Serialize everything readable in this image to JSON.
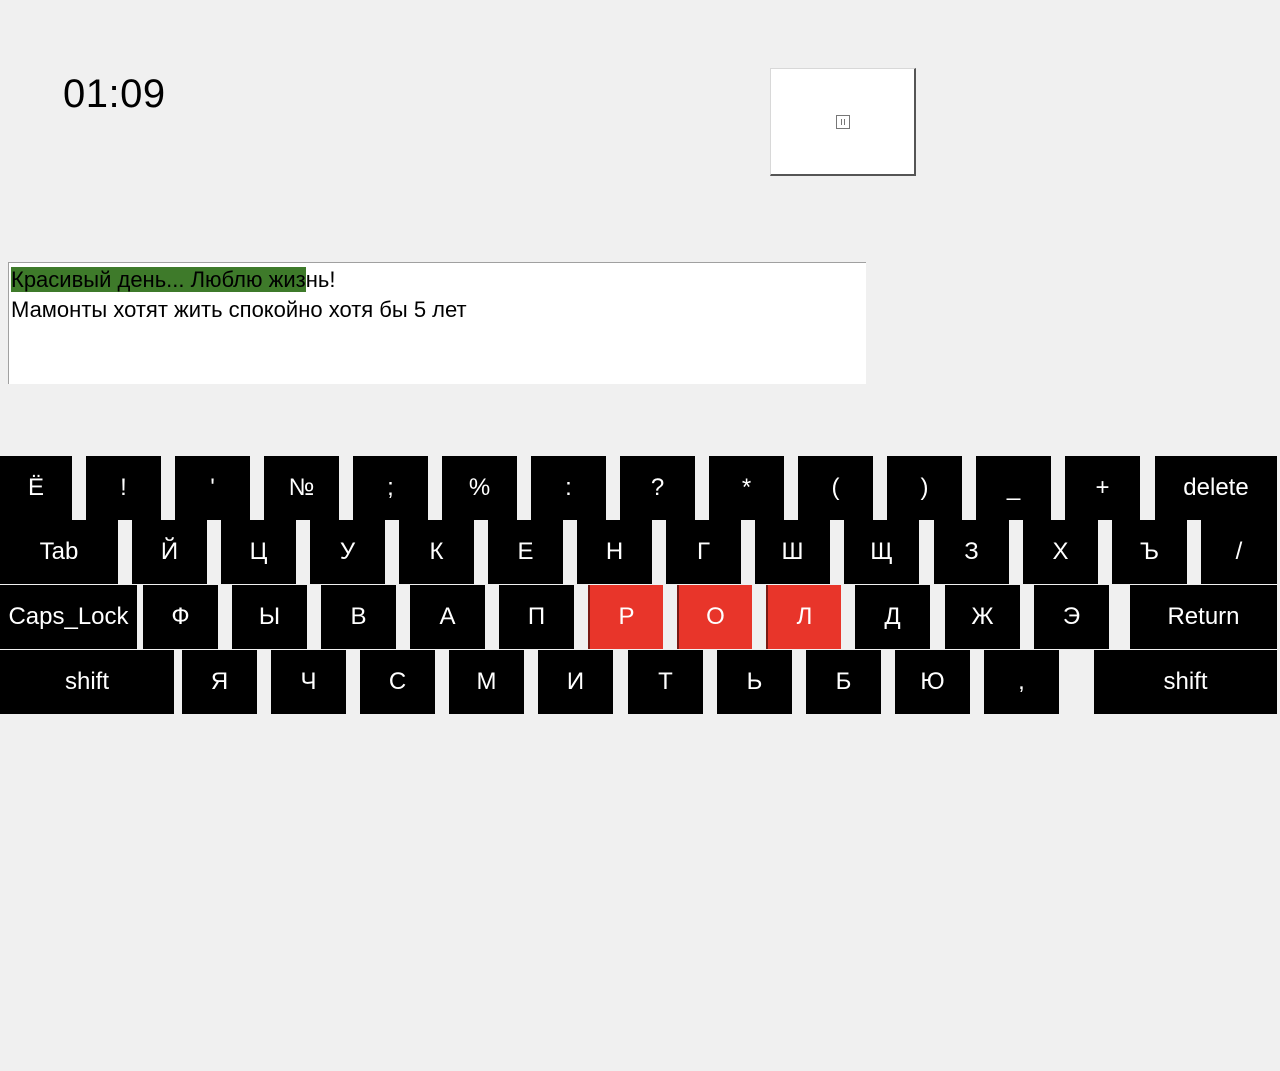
{
  "timer": "01:09",
  "pause_button": {
    "icon": "pause-icon"
  },
  "text": {
    "line1_typed": "Красивый день... Люблю жиз",
    "line1_rest": "нь!",
    "line2": "Мамонты хотят жить спокойно хотя бы 5 лет"
  },
  "colors": {
    "typed_highlight": "#3e7a2a",
    "key_highlight": "#e8352a",
    "key": "#000000"
  },
  "keyboard": {
    "rows": [
      [
        "Ё",
        "!",
        "'",
        "№",
        ";",
        "%",
        ":",
        "?",
        "*",
        "(",
        ")",
        "_",
        "+",
        "delete"
      ],
      [
        "Tab",
        "Й",
        "Ц",
        "У",
        "К",
        "Е",
        "Н",
        "Г",
        "Ш",
        "Щ",
        "З",
        "Х",
        "Ъ",
        "/"
      ],
      [
        "Caps_Lock",
        "Ф",
        "Ы",
        "В",
        "А",
        "П",
        "Р",
        "О",
        "Л",
        "Д",
        "Ж",
        "Э",
        "Return"
      ],
      [
        "shift",
        "Я",
        "Ч",
        "С",
        "М",
        "И",
        "Т",
        "Ь",
        "Б",
        "Ю",
        ",",
        "shift"
      ]
    ],
    "highlighted": [
      "Р",
      "О",
      "Л"
    ]
  }
}
